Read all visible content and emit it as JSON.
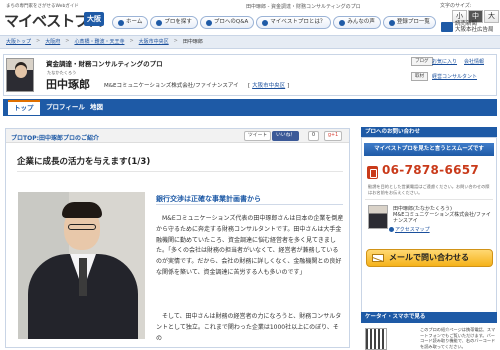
{
  "header": {
    "tagline": "まちの専門家をさがせるWebガイド",
    "logo": "マイベストプロ",
    "region": "大阪",
    "topline": "田中琢郎 - 資金調達・財務コンサルティングのプロ",
    "font_size_label": "文字のサイズ:",
    "font_sizes": [
      "小",
      "中",
      "大"
    ],
    "nav": [
      "ホーム",
      "プロを探す",
      "プロへのQ&A",
      "マイベストプロとは？",
      "みんなの声",
      "登録プロ一覧"
    ],
    "partner": [
      "読売新聞",
      "大阪本社広告局"
    ]
  },
  "breadcrumb": [
    "大阪トップ",
    "大阪府",
    "心斎橋・難波・天王寺",
    "大阪市中央区",
    "田中琢郎"
  ],
  "profile": {
    "headline": "資金調達・財務コンサルティングのプロ",
    "kana": "たなかたくろう",
    "name": "田中琢郎",
    "company": "M&Eコミュニケーションズ株式会社/ファイナンスアイ",
    "area_open": "[",
    "area": "大阪市中央区",
    "area_close": "]",
    "blog_button": "ブログ",
    "blog_link": "お気に入り",
    "share_link": "会社情報",
    "share_button": "取材",
    "consultant_link": "経営コンサルタント"
  },
  "tabs": [
    "トップ",
    "プロフィール",
    "地図"
  ],
  "article": {
    "section": "プロTOP:田中琢郎プロのご紹介",
    "tweet": "ツイート",
    "like": "いいね！",
    "like_count": "0",
    "gplus": "g+1",
    "title": "企業に成長の活力を与えます(1/3)",
    "subtitle": "銀行交渉は正確な事業計画書から",
    "p1": "　M&Eコミュニケーションズ代表の田中琢郎さんは日本の企業を倒産から守るために奔走する財務コンサルタントです。田中さんは大手金融機関に勤めていたころ、資金調達に悩む経営者を多く見てきました。「多くの会社は財務の担当者がいなくて、経営者が兼務しているのが実情です。だから、会社の財務に詳しくなく、金融機関との良好な関係を築いて、資金調達に苦労する人も多いのです」",
    "p2": "　そして、田中さんは財務の経営者の力になろうと、財務コンサルタントとして独立。これまで関わった企業は1000社以上にのぼり、その"
  },
  "side": {
    "contact_head": "プロへのお問い合わせ",
    "banner": "マイベストプロを見たと言うとスムーズです",
    "phone": "06-7878-6657",
    "note": "勧誘を目的とした営業電話はご遠慮ください。お問い合わせの際はお名前をお伝えください。",
    "rep": "田中琢郎(たなかたくろう)",
    "rep_company": "M&Eコミュニケーションズ株式会社/ファイナンスアイ",
    "access": "アクセスマップ",
    "mail_button": "メールで問い合わせる",
    "mobile_head": "ケータイ・スマホで見る",
    "qr_text": "このプロの紹介ページは携帯電話、スマートフォンでもご覧いただけます。バーコード読み取り機能で、右のバーコードを読み取ってください。"
  }
}
